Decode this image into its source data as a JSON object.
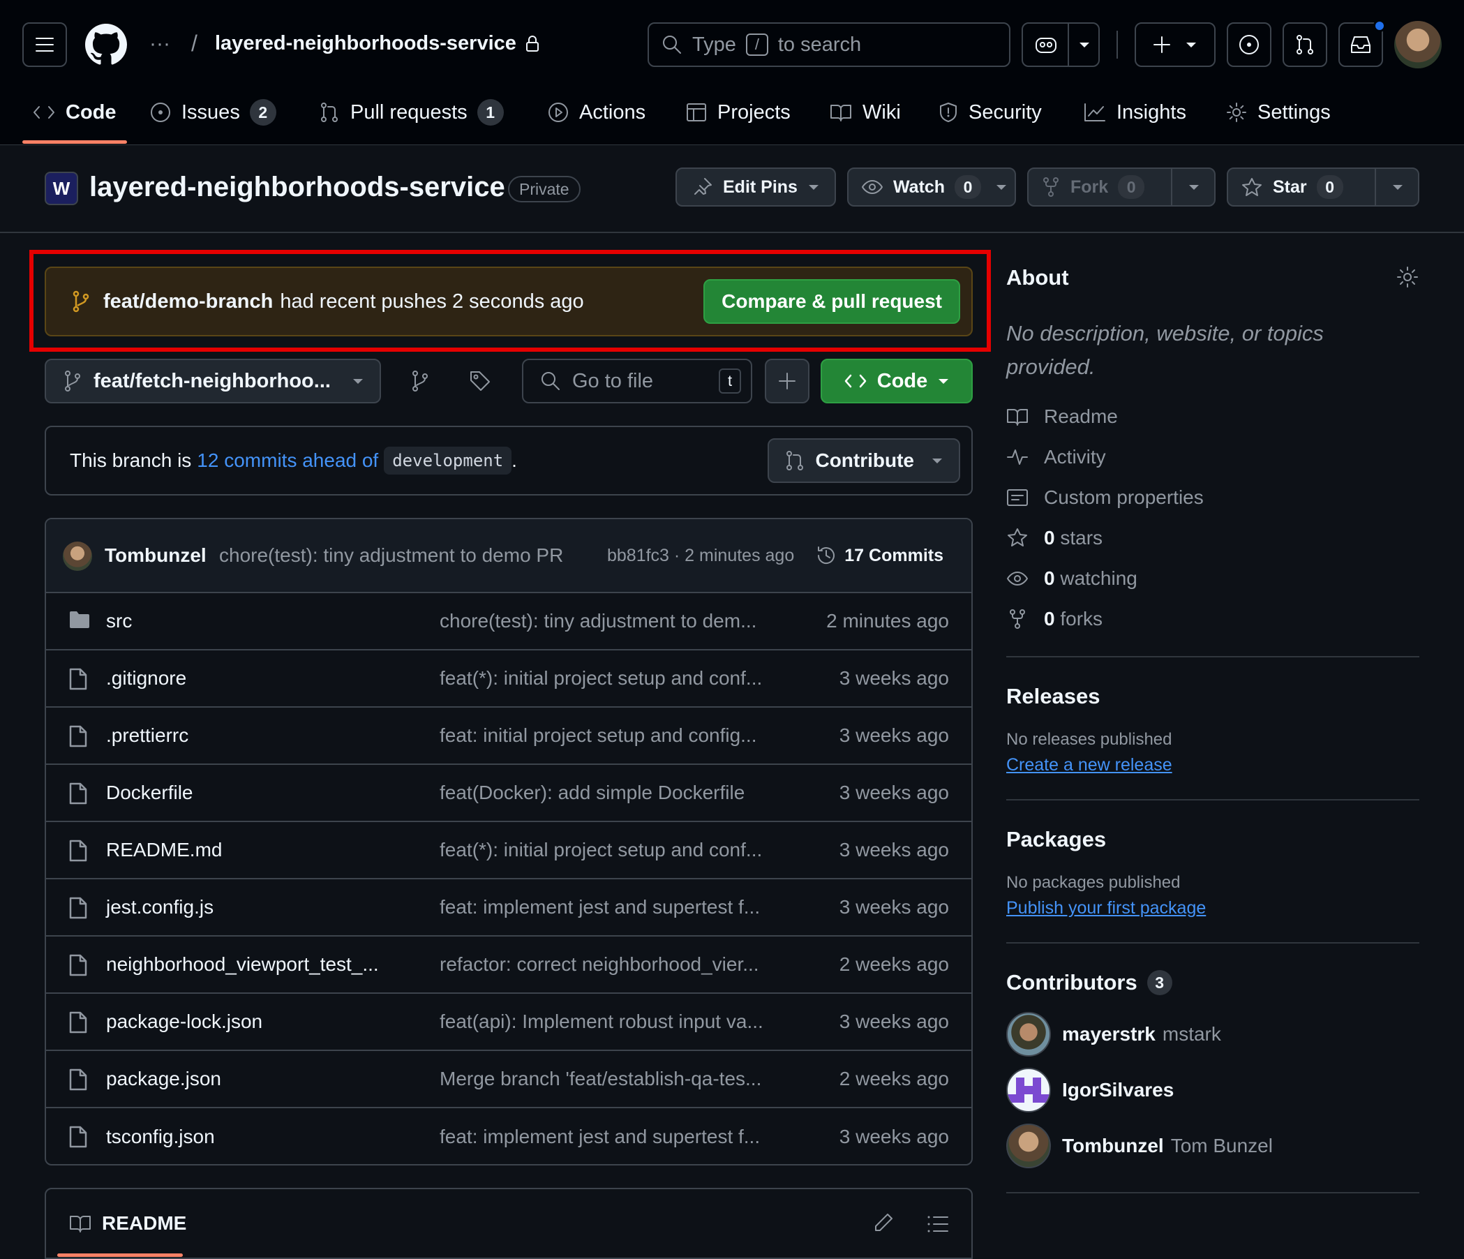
{
  "header": {
    "owner_ellipsis": "···",
    "separator": "/",
    "repo_name": "layered-neighborhoods-service",
    "search": {
      "prefix": "Type",
      "key": "/",
      "suffix": "to search"
    }
  },
  "tabs": [
    {
      "label": "Code"
    },
    {
      "label": "Issues",
      "count": "2"
    },
    {
      "label": "Pull requests",
      "count": "1"
    },
    {
      "label": "Actions"
    },
    {
      "label": "Projects"
    },
    {
      "label": "Wiki"
    },
    {
      "label": "Security"
    },
    {
      "label": "Insights"
    },
    {
      "label": "Settings"
    }
  ],
  "repo": {
    "avatar_letter": "W",
    "title": "layered-neighborhoods-service",
    "visibility": "Private",
    "edit_pins": "Edit Pins",
    "watch": "Watch",
    "watch_count": "0",
    "fork": "Fork",
    "fork_count": "0",
    "star": "Star",
    "star_count": "0"
  },
  "banner": {
    "branch": "feat/demo-branch",
    "text": "had recent pushes 2 seconds ago",
    "button": "Compare & pull request"
  },
  "controls": {
    "branch": "feat/fetch-neighborhoo...",
    "go_to_file": "Go to file",
    "go_to_file_key": "t",
    "code_button": "Code"
  },
  "ahead": {
    "prefix": "This branch is",
    "link": "12 commits ahead of",
    "base": "development",
    "suffix": ".",
    "contribute": "Contribute"
  },
  "last_commit": {
    "author": "Tombunzel",
    "message": "chore(test): tiny adjustment to demo PR",
    "sha_time": "bb81fc3 · 2 minutes ago",
    "commits": "17 Commits"
  },
  "files": [
    {
      "type": "folder",
      "name": "src",
      "message": "chore(test): tiny adjustment to dem...",
      "date": "2 minutes ago"
    },
    {
      "type": "file",
      "name": ".gitignore",
      "message": "feat(*): initial project setup and conf...",
      "date": "3 weeks ago"
    },
    {
      "type": "file",
      "name": ".prettierrc",
      "message": "feat: initial project setup and config...",
      "date": "3 weeks ago"
    },
    {
      "type": "file",
      "name": "Dockerfile",
      "message": "feat(Docker): add simple Dockerfile",
      "date": "3 weeks ago"
    },
    {
      "type": "file",
      "name": "README.md",
      "message": "feat(*): initial project setup and conf...",
      "date": "3 weeks ago"
    },
    {
      "type": "file",
      "name": "jest.config.js",
      "message": "feat: implement jest and supertest f...",
      "date": "3 weeks ago"
    },
    {
      "type": "file",
      "name": "neighborhood_viewport_test_...",
      "message": "refactor: correct neighborhood_vier...",
      "date": "2 weeks ago"
    },
    {
      "type": "file",
      "name": "package-lock.json",
      "message": "feat(api): Implement robust input va...",
      "date": "3 weeks ago"
    },
    {
      "type": "file",
      "name": "package.json",
      "message": "Merge branch 'feat/establish-qa-tes...",
      "date": "2 weeks ago"
    },
    {
      "type": "file",
      "name": "tsconfig.json",
      "message": "feat: implement jest and supertest f...",
      "date": "3 weeks ago"
    }
  ],
  "readme": {
    "title": "README"
  },
  "about": {
    "title": "About",
    "description": "No description, website, or topics provided.",
    "readme": "Readme",
    "activity": "Activity",
    "custom_properties": "Custom properties",
    "stars_count": "0",
    "stars_label": "stars",
    "watching_count": "0",
    "watching_label": "watching",
    "forks_count": "0",
    "forks_label": "forks"
  },
  "releases": {
    "title": "Releases",
    "empty": "No releases published",
    "link": "Create a new release"
  },
  "packages": {
    "title": "Packages",
    "empty": "No packages published",
    "link": "Publish your first package"
  },
  "contributors": {
    "title": "Contributors",
    "count": "3",
    "people": [
      {
        "login": "mayerstrk",
        "name": "mstark"
      },
      {
        "login": "IgorSilvares",
        "name": ""
      },
      {
        "login": "Tombunzel",
        "name": "Tom Bunzel"
      }
    ]
  },
  "colors": {
    "accent_green": "#238636",
    "link_blue": "#4493f8",
    "highlight_red": "#e50000",
    "tab_underline": "#f78166"
  }
}
